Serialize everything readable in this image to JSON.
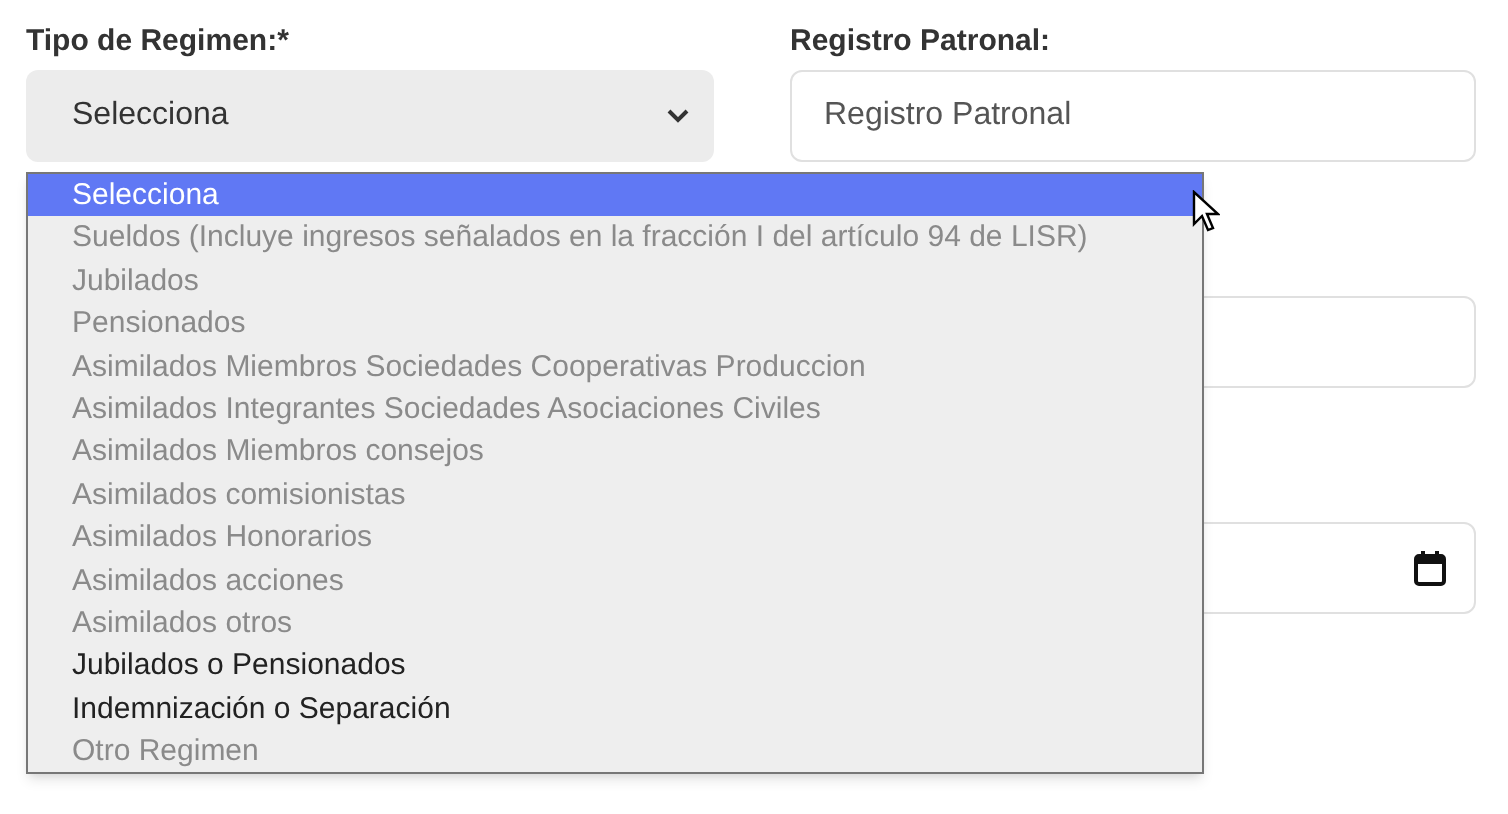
{
  "regimen": {
    "label": "Tipo de Regimen:*",
    "value": "Selecciona",
    "expanded": true,
    "options": [
      {
        "label": "Selecciona",
        "selected": true,
        "disabled": false
      },
      {
        "label": "Sueldos (Incluye ingresos señalados en la fracción I del artículo 94 de LISR)",
        "selected": false,
        "disabled": true
      },
      {
        "label": "Jubilados",
        "selected": false,
        "disabled": true
      },
      {
        "label": "Pensionados",
        "selected": false,
        "disabled": true
      },
      {
        "label": "Asimilados Miembros Sociedades Cooperativas Produccion",
        "selected": false,
        "disabled": true
      },
      {
        "label": "Asimilados Integrantes Sociedades Asociaciones Civiles",
        "selected": false,
        "disabled": true
      },
      {
        "label": "Asimilados Miembros consejos",
        "selected": false,
        "disabled": true
      },
      {
        "label": "Asimilados comisionistas",
        "selected": false,
        "disabled": true
      },
      {
        "label": "Asimilados Honorarios",
        "selected": false,
        "disabled": true
      },
      {
        "label": "Asimilados acciones",
        "selected": false,
        "disabled": true
      },
      {
        "label": "Asimilados otros",
        "selected": false,
        "disabled": true
      },
      {
        "label": "Jubilados o Pensionados",
        "selected": false,
        "disabled": false
      },
      {
        "label": "Indemnización o Separación",
        "selected": false,
        "disabled": false
      },
      {
        "label": "Otro Regimen",
        "selected": false,
        "disabled": true
      }
    ]
  },
  "right_fields": [
    {
      "kind": "text",
      "label": "Registro Patronal:",
      "placeholder": "Registro Patronal"
    },
    {
      "kind": "text"
    },
    {
      "kind": "date"
    }
  ]
}
